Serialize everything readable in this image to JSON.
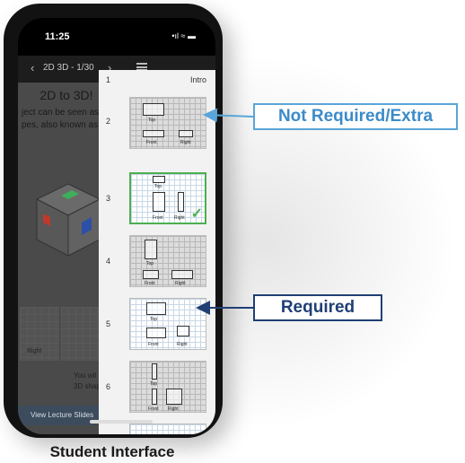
{
  "status_bar": {
    "time": "11:25",
    "icons": "•ıl ≈ ▬"
  },
  "app_header": {
    "back_icon": "‹",
    "title": "2D 3D - 1/30",
    "forward_icon": "›",
    "menu_icon": "hamburger-menu",
    "close_icon": "✕"
  },
  "lesson": {
    "heading": "2D to 3D!",
    "line1": "ject can be seen as",
    "line2": "pes, also known as t",
    "grid_label": "Right",
    "note1": "You wil",
    "note2": "3D shap",
    "slides_button": "View Lecture Slides"
  },
  "slide_panel": {
    "intro": {
      "number": "1",
      "label": "Intro"
    },
    "slides": [
      {
        "number": "2",
        "labels": [
          "Top",
          "Front",
          "Right"
        ]
      },
      {
        "number": "3",
        "labels": [
          "Top",
          "Front",
          "Right"
        ]
      },
      {
        "number": "4",
        "labels": [
          "Top",
          "Front",
          "Right"
        ]
      },
      {
        "number": "5",
        "labels": [
          "Top",
          "Front",
          "Right"
        ]
      },
      {
        "number": "6",
        "labels": [
          "Top",
          "Front",
          "Right"
        ]
      }
    ]
  },
  "callouts": {
    "extra": "Not Required/Extra",
    "required": "Required"
  },
  "caption": "Student Interface",
  "colors": {
    "extra_blue": "#3b8bc9",
    "required_navy": "#1f3f74",
    "active_green": "#4caf50"
  }
}
